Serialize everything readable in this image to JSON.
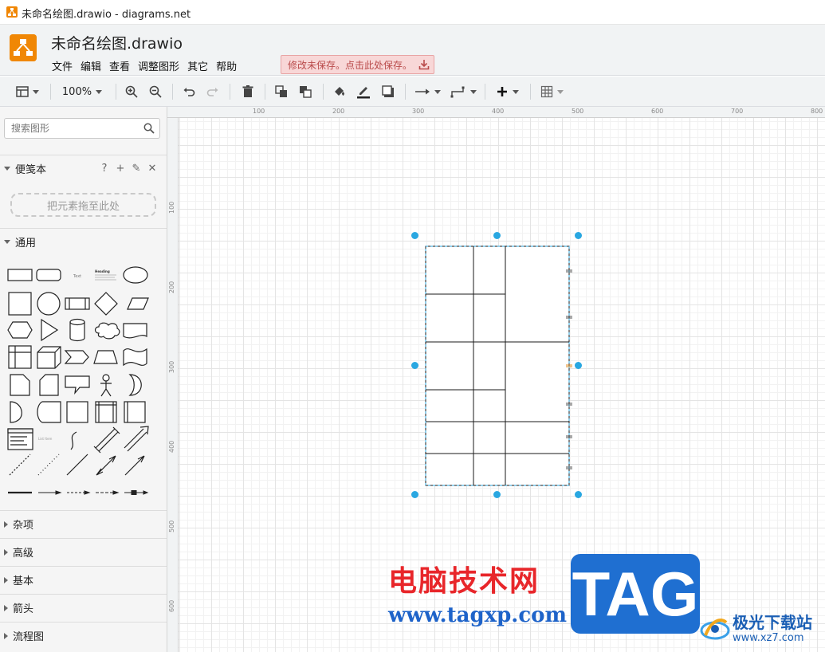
{
  "window": {
    "title": "未命名绘图.drawio - diagrams.net"
  },
  "app": {
    "doc_title": "未命名绘图.drawio",
    "menu": [
      "文件",
      "编辑",
      "查看",
      "调整图形",
      "其它",
      "帮助"
    ],
    "save_warning": "修改未保存。点击此处保存。",
    "brand_color": "#f08705",
    "warn_color": "#b94a4a"
  },
  "toolbar": {
    "zoom": "100%",
    "icons": [
      "format-panel-icon",
      "zoom-in-icon",
      "zoom-out-icon",
      "undo-icon",
      "redo-icon",
      "delete-icon",
      "to-front-icon",
      "to-back-icon",
      "fill-color-icon",
      "line-color-icon",
      "shadow-icon",
      "connection-icon",
      "waypoint-icon",
      "insert-icon",
      "table-icon"
    ]
  },
  "sidebar": {
    "search_placeholder": "搜索图形",
    "scratchpad": {
      "label": "便笺本",
      "tools": [
        "?",
        "+",
        "✎",
        "✕"
      ],
      "drop_hint": "把元素拖至此处"
    },
    "general": {
      "label": "通用"
    },
    "shape_text": {
      "text": "Text",
      "heading": "Heading",
      "list_item": "List Item"
    },
    "collapsed_sections": [
      "杂项",
      "高级",
      "基本",
      "箭头",
      "流程图"
    ]
  },
  "canvas": {
    "ruler_top": [
      "100",
      "200",
      "300",
      "400",
      "500",
      "600",
      "700",
      "800"
    ],
    "ruler_left": [
      "100",
      "200",
      "300",
      "400",
      "500",
      "600"
    ],
    "selection_color": "#29a7e1"
  },
  "watermark": {
    "cn": "电脑技术网",
    "url": "www.tagxp.com",
    "tag": "TAG",
    "site_cn": "极光下载站",
    "site_url": "www.xz7.com"
  }
}
